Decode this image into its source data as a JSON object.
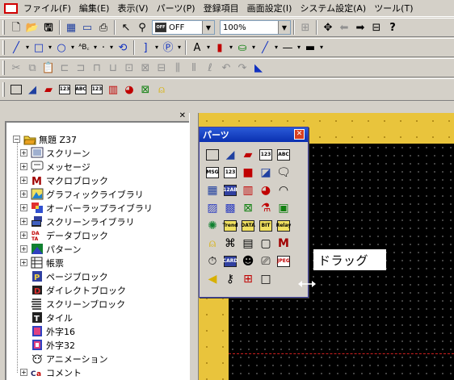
{
  "menubar": {
    "items": [
      "ファイル(F)",
      "編集(E)",
      "表示(V)",
      "パーツ(P)",
      "登録項目",
      "画面設定(I)",
      "システム設定(A)",
      "ツール(T)"
    ]
  },
  "toolbar": {
    "bitmap_value": "OFF",
    "bitmap_badge": "OFF",
    "zoom_value": "100%",
    "font_label": "ᴬB꜀"
  },
  "tree": {
    "root": "無題 Z37",
    "items": [
      {
        "label": "スクリーン",
        "icon": "screen-icon",
        "expandable": true
      },
      {
        "label": "メッセージ",
        "icon": "message-icon",
        "expandable": true
      },
      {
        "label": "マクロブロック",
        "icon": "macro-icon",
        "expandable": true
      },
      {
        "label": "グラフィックライブラリ",
        "icon": "graphic-library-icon",
        "expandable": true
      },
      {
        "label": "オーバーラップライブラリ",
        "icon": "overlap-library-icon",
        "expandable": true
      },
      {
        "label": "スクリーンライブラリ",
        "icon": "screen-library-icon",
        "expandable": true
      },
      {
        "label": "データブロック",
        "icon": "data-block-icon",
        "expandable": true
      },
      {
        "label": "パターン",
        "icon": "pattern-icon",
        "expandable": true
      },
      {
        "label": "帳票",
        "icon": "report-icon",
        "expandable": true
      },
      {
        "label": "ページブロック",
        "icon": "page-block-icon",
        "expandable": false
      },
      {
        "label": "ダイレクトブロック",
        "icon": "direct-block-icon",
        "expandable": false
      },
      {
        "label": "スクリーンブロック",
        "icon": "screen-block-icon",
        "expandable": false
      },
      {
        "label": "タイル",
        "icon": "tile-icon",
        "expandable": false
      },
      {
        "label": "外字16",
        "icon": "external-char-16-icon",
        "expandable": false
      },
      {
        "label": "外字32",
        "icon": "external-char-32-icon",
        "expandable": false
      },
      {
        "label": "アニメーション",
        "icon": "animation-icon",
        "expandable": false
      },
      {
        "label": "コメント",
        "icon": "comment-icon",
        "expandable": true
      }
    ]
  },
  "palette": {
    "title": "パーツ",
    "close": "✕",
    "badges": {
      "num123": "123",
      "abc": "ABC",
      "msg": "MSG",
      "num123b": "123",
      "num12ab": "12AB",
      "trend": "Trend",
      "data": "DATA",
      "bit": "BIT",
      "relay": "Relay",
      "card": "CARD",
      "jpeg": "JPEG"
    }
  },
  "overlay": {
    "drag_label": "ドラッグ"
  },
  "colors": {
    "canvas_yellow": "#e9c43c",
    "screen_black": "#000000",
    "title_blue": "#0a30b0",
    "red_accent": "#d00000"
  }
}
